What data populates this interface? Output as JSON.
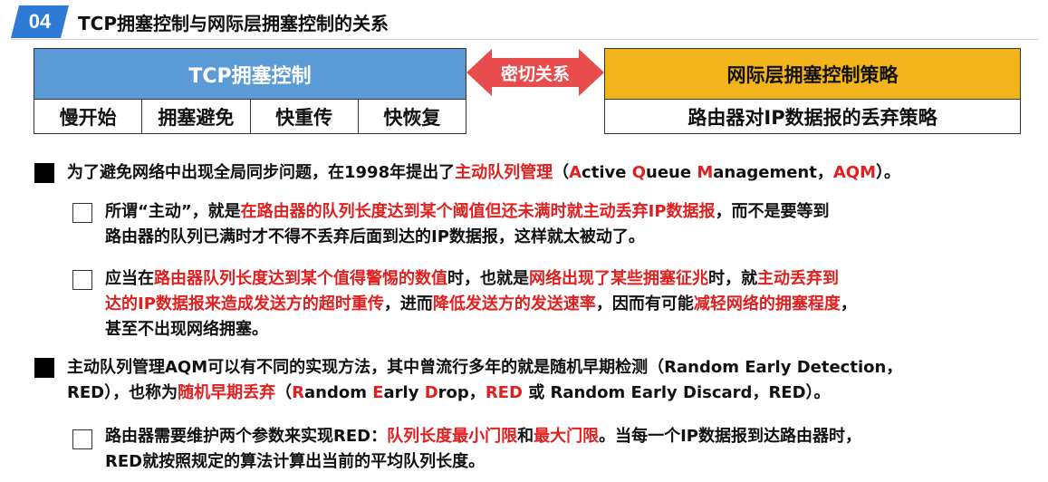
{
  "header": {
    "badge": "04",
    "title": "TCP拥塞控制与网际层拥塞控制的关系"
  },
  "diagram": {
    "left": {
      "title": "TCP拥塞控制",
      "items": [
        "慢开始",
        "拥塞避免",
        "快重传",
        "快恢复"
      ]
    },
    "arrow_label": "密切关系",
    "right": {
      "title": "网际层拥塞控制策略",
      "item": "路由器对IP数据报的丢弃策略"
    },
    "colors": {
      "left_header": "#5b9bd5",
      "right_header": "#f1b41b",
      "arrow": "#e84c4c",
      "badge": "#2e7bd6",
      "highlight": "#e02020"
    }
  },
  "bullets": {
    "b1": {
      "p1": "为了避免网络中出现全局同步问题，在1998年提出了",
      "r1": "主动队列管理",
      "p2": "（",
      "r2": "A",
      "p3": "ctive ",
      "r3": "Q",
      "p4": "ueue ",
      "r4": "M",
      "p5": "anagement，",
      "r5": "AQM",
      "p6": "）。"
    },
    "s1": {
      "l1_a": "所谓“主动”，就是",
      "l1_r": "在路由器的队列长度达到某个阈值但还未满时就主动丢弃IP数据报",
      "l1_b": "，而不是要等到",
      "l2": "路由器的队列已满时才不得不丢弃后面到达的IP数据报，这样就太被动了。"
    },
    "s2": {
      "l1_a": "应当在",
      "l1_r1": "路由器队列长度达到某个值得警惕的数值",
      "l1_b": "时，也就是",
      "l1_r2": "网络出现了某些拥塞征兆",
      "l1_c": "时，就",
      "l1_r3": "主动丢弃到",
      "l2_r1": "达的IP数据报来造成发送方的超时重传",
      "l2_a": "，进而",
      "l2_r2": "降低发送方的发送速率",
      "l2_b": "，因而有可能",
      "l2_r3": "减轻网络的拥塞程度",
      "l2_c": "，",
      "l3": "甚至不出现网络拥塞。"
    },
    "b2": {
      "l1": "主动队列管理AQM可以有不同的实现方法，其中曾流行多年的就是随机早期检测（Random Early Detection，",
      "l2_a": "RED），也称为",
      "l2_r1": "随机早期丢弃",
      "l2_b": "（",
      "l2_r2": "R",
      "l2_c": "andom ",
      "l2_r3": "E",
      "l2_d": "arly ",
      "l2_r4": "D",
      "l2_e": "rop，",
      "l2_r5": "RED",
      "l2_f": " 或 Random Early Discard，RED）。"
    },
    "s3": {
      "l1_a": "路由器需要维护两个参数来实现RED：",
      "l1_r1": "队列长度最小门限",
      "l1_b": "和",
      "l1_r2": "最大门限",
      "l1_c": "。当每一个IP数据报到达路由器时，",
      "l2": "RED就按照规定的算法计算出当前的平均队列长度。"
    }
  }
}
